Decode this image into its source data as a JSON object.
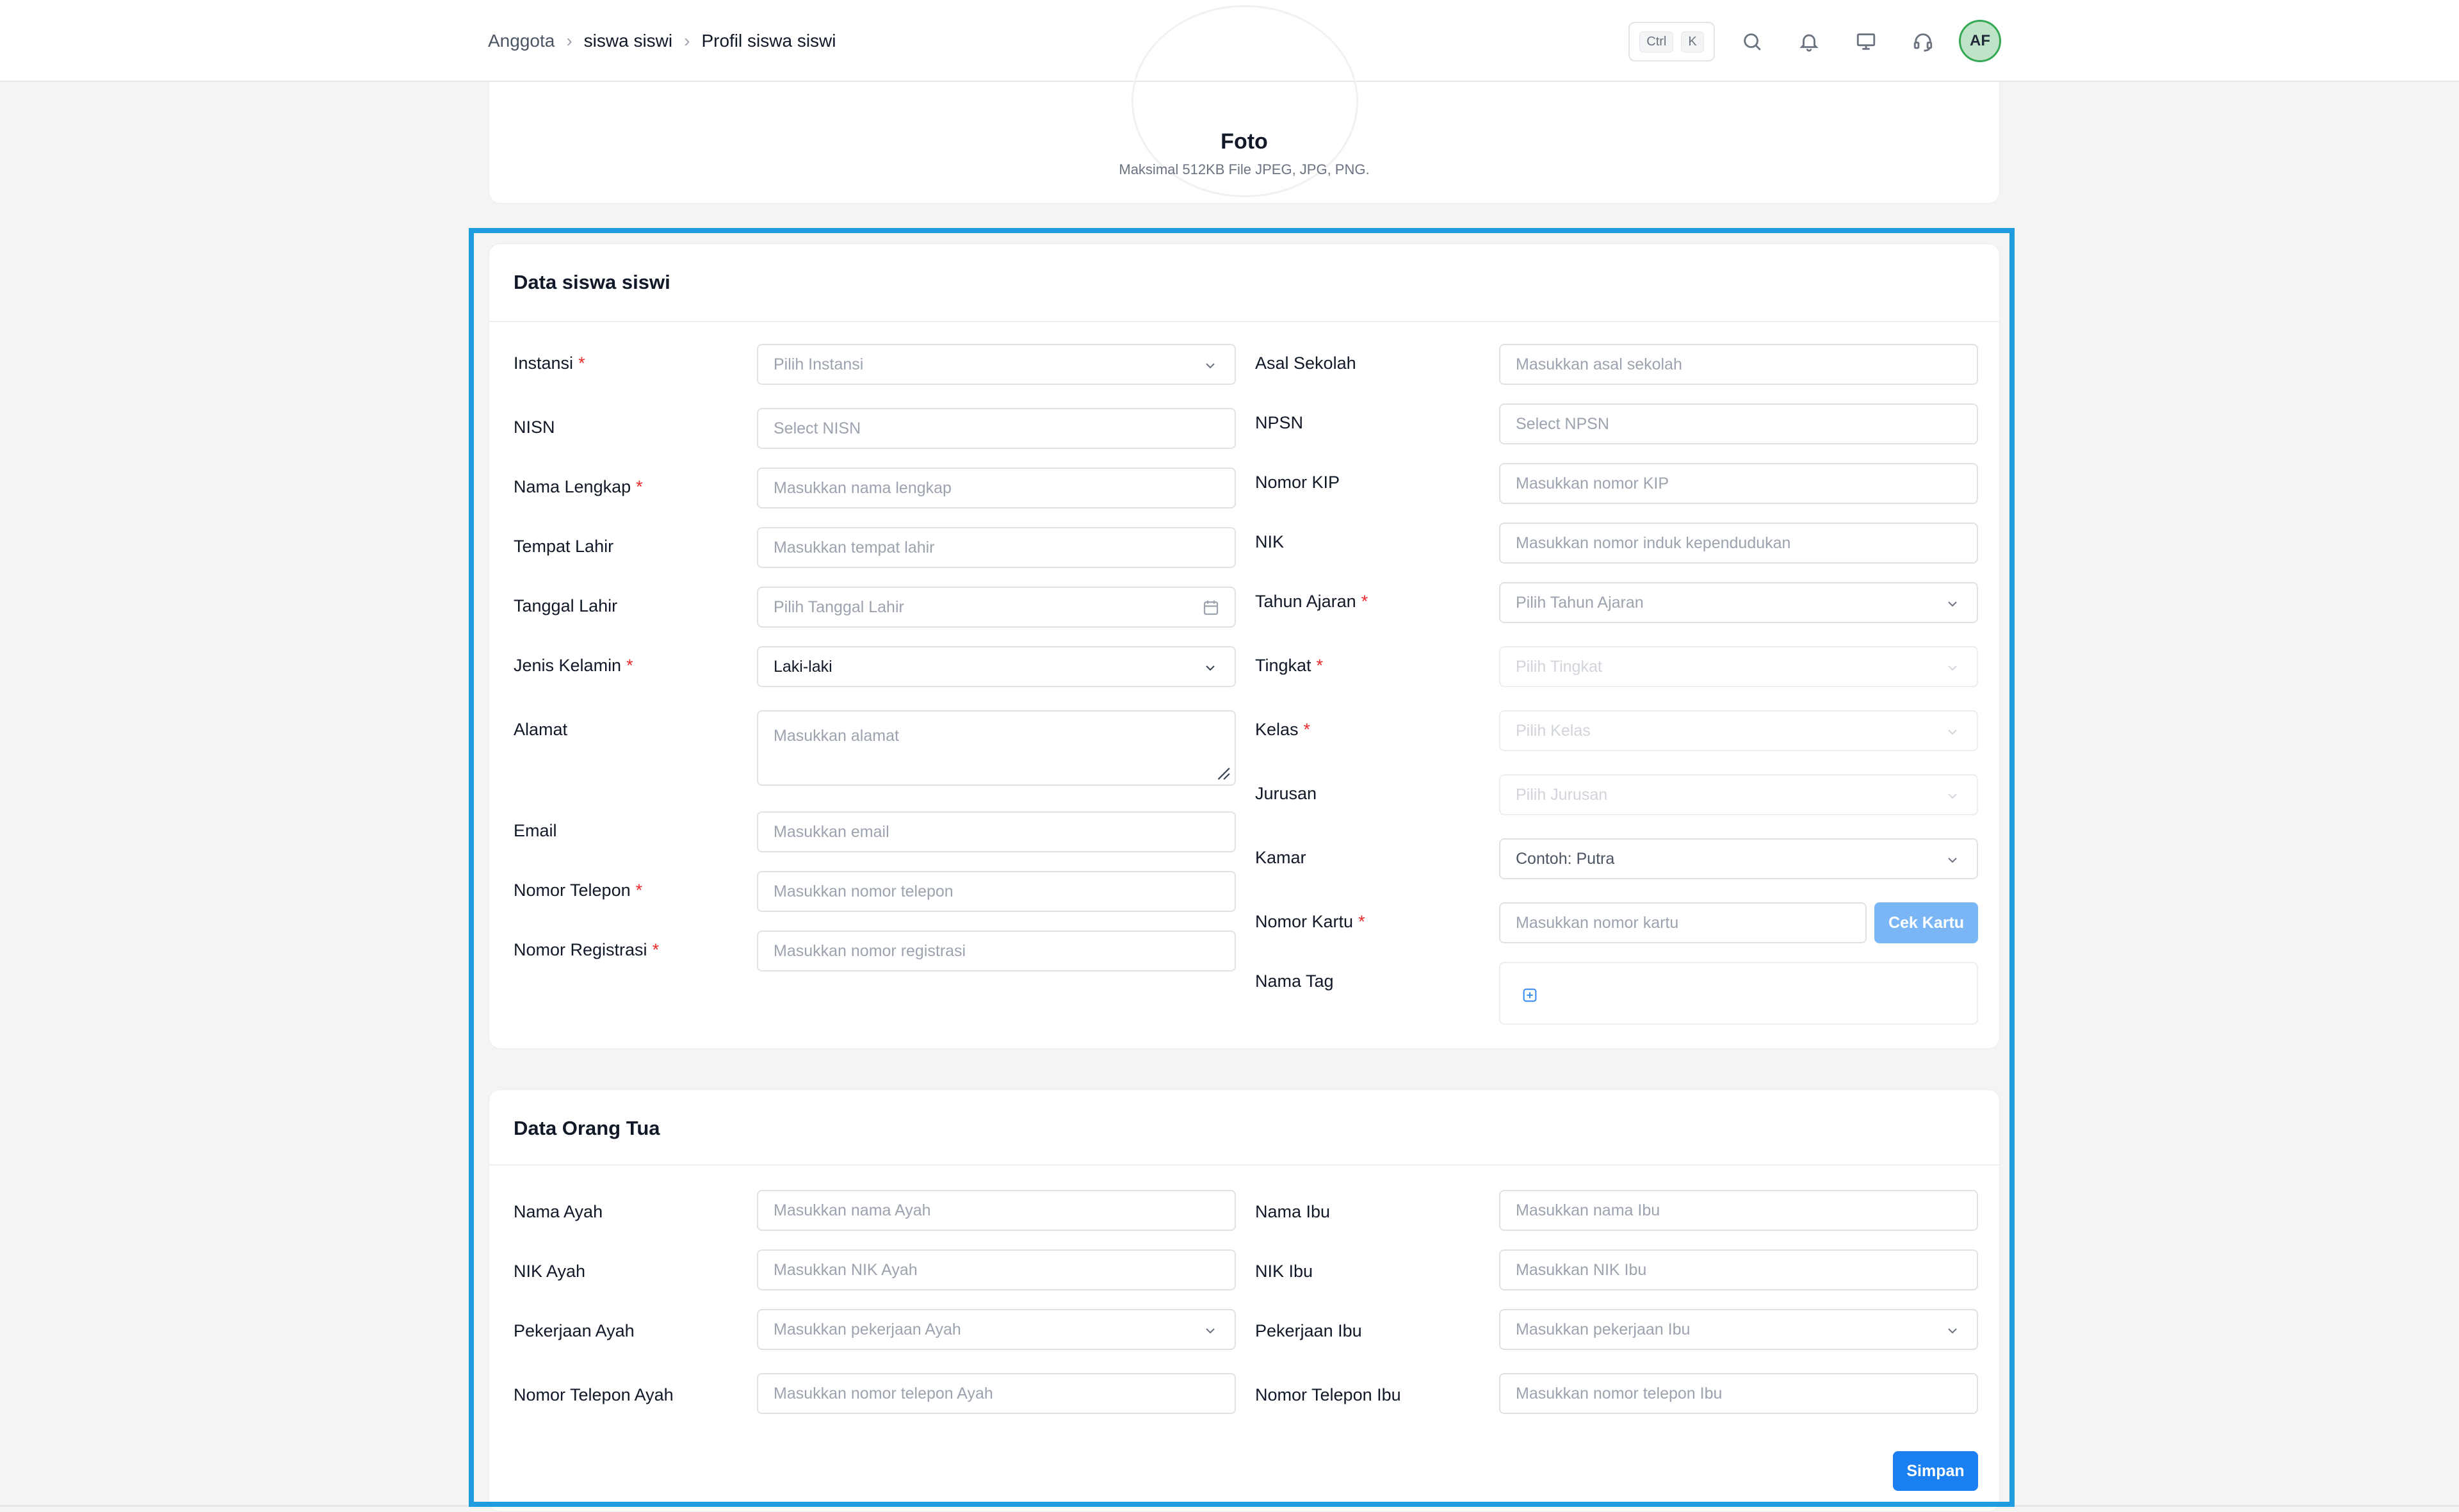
{
  "breadcrumb": {
    "items": [
      "Anggota",
      "siswa siswi",
      "Profil siswa siswi"
    ],
    "separator": "›"
  },
  "header": {
    "kbd_ctrl": "Ctrl",
    "kbd_k": "K",
    "avatar_initials": "AF",
    "icons": [
      "search-icon",
      "bell-icon",
      "monitor-icon",
      "headset-icon"
    ]
  },
  "photo": {
    "title": "Foto",
    "subtitle": "Maksimal 512KB File JPEG, JPG, PNG."
  },
  "student": {
    "title": "Data siswa siswi",
    "left": [
      {
        "label": "Instansi",
        "required": "*",
        "placeholder": "Pilih Instansi",
        "type": "select"
      },
      {
        "label": "NISN",
        "required": "",
        "placeholder": "Select NISN",
        "type": "input"
      },
      {
        "label": "Nama Lengkap",
        "required": "*",
        "placeholder": "Masukkan nama lengkap",
        "type": "input"
      },
      {
        "label": "Tempat Lahir",
        "required": "",
        "placeholder": "Masukkan tempat lahir",
        "type": "input"
      },
      {
        "label": "Tanggal Lahir",
        "required": "",
        "placeholder": "Pilih Tanggal Lahir",
        "type": "date"
      },
      {
        "label": "Jenis Kelamin",
        "required": "*",
        "value": "Laki-laki",
        "type": "select"
      },
      {
        "label": "Alamat",
        "required": "",
        "placeholder": "Masukkan alamat",
        "type": "textarea"
      },
      {
        "label": "Email",
        "required": "",
        "placeholder": "Masukkan email",
        "type": "input"
      },
      {
        "label": "Nomor Telepon",
        "required": "*",
        "placeholder": "Masukkan nomor telepon",
        "type": "input"
      },
      {
        "label": "Nomor Registrasi",
        "required": "*",
        "placeholder": "Masukkan nomor registrasi",
        "type": "input"
      }
    ],
    "right": [
      {
        "label": "Asal Sekolah",
        "required": "",
        "placeholder": "Masukkan asal sekolah",
        "type": "input"
      },
      {
        "label": "NPSN",
        "required": "",
        "placeholder": "Select NPSN",
        "type": "input"
      },
      {
        "label": "Nomor KIP",
        "required": "",
        "placeholder": "Masukkan nomor KIP",
        "type": "input"
      },
      {
        "label": "NIK",
        "required": "",
        "placeholder": "Masukkan nomor induk kependudukan",
        "type": "input"
      },
      {
        "label": "Tahun Ajaran",
        "required": "*",
        "placeholder": "Pilih Tahun Ajaran",
        "type": "select"
      },
      {
        "label": "Tingkat",
        "required": "*",
        "placeholder": "Pilih Tingkat",
        "type": "select-disabled"
      },
      {
        "label": "Kelas",
        "required": "*",
        "placeholder": "Pilih Kelas",
        "type": "select-disabled"
      },
      {
        "label": "Jurusan",
        "required": "",
        "placeholder": "Pilih Jurusan",
        "type": "select-disabled"
      },
      {
        "label": "Kamar",
        "required": "",
        "placeholder": "Contoh: Putra",
        "type": "select"
      },
      {
        "label": "Nomor Kartu",
        "required": "*",
        "placeholder": "Masukkan nomor kartu",
        "type": "input-button",
        "button": "Cek Kartu"
      },
      {
        "label": "Nama Tag",
        "required": "",
        "type": "tags"
      }
    ]
  },
  "parents": {
    "title": "Data Orang Tua",
    "left": [
      {
        "label": "Nama Ayah",
        "placeholder": "Masukkan nama Ayah",
        "type": "input"
      },
      {
        "label": "NIK Ayah",
        "placeholder": "Masukkan NIK Ayah",
        "type": "input"
      },
      {
        "label": "Pekerjaan Ayah",
        "placeholder": "Masukkan pekerjaan Ayah",
        "type": "select"
      },
      {
        "label": "Nomor Telepon Ayah",
        "placeholder": "Masukkan nomor telepon Ayah",
        "type": "input"
      }
    ],
    "right": [
      {
        "label": "Nama Ibu",
        "placeholder": "Masukkan nama Ibu",
        "type": "input"
      },
      {
        "label": "NIK Ibu",
        "placeholder": "Masukkan NIK Ibu",
        "type": "input"
      },
      {
        "label": "Pekerjaan Ibu",
        "placeholder": "Masukkan pekerjaan Ibu",
        "type": "select"
      },
      {
        "label": "Nomor Telepon Ibu",
        "placeholder": "Masukkan nomor telepon Ibu",
        "type": "input"
      }
    ],
    "save_label": "Simpan"
  },
  "colors": {
    "accent": "#1a7ff0",
    "accent_light": "#7ab6f5",
    "highlight_frame": "#1f9be0",
    "required": "#ef2b2b",
    "avatar_bg": "#bfe3c9",
    "avatar_border": "#34a853"
  }
}
